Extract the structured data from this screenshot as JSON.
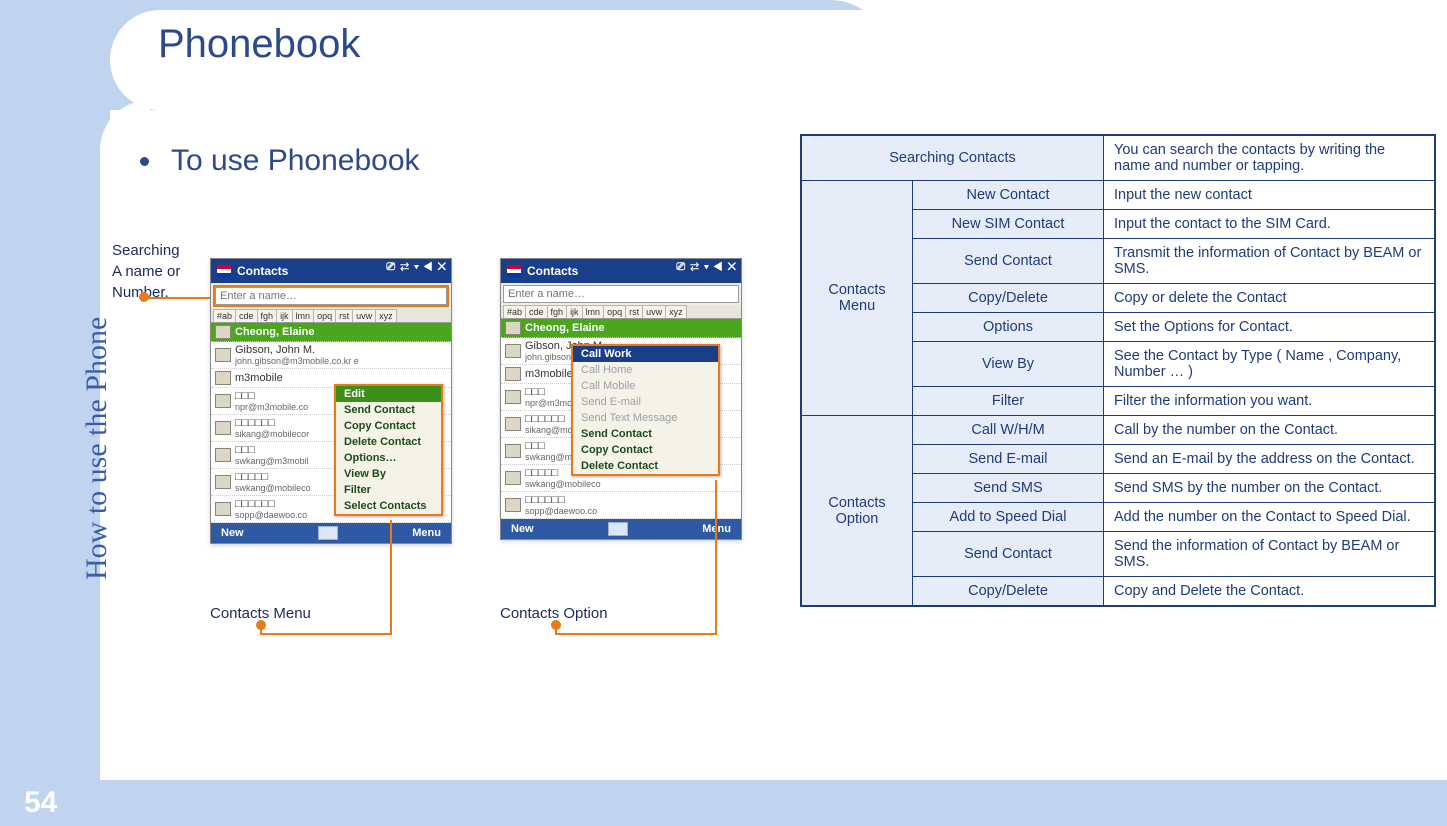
{
  "page": {
    "title": "Phonebook",
    "sidebar_text": "How to use the Phone",
    "sub_title": "To use Phonebook",
    "page_number": "54",
    "search_caption_line1": "Searching",
    "search_caption_line2": "A name or",
    "search_caption_line3": "Number.",
    "caption_menu": "Contacts Menu",
    "caption_option": "Contacts Option"
  },
  "screenshot": {
    "window_title": "Contacts",
    "tray_icons": "⎚ ⇄ ▾ ◀ ✕",
    "input_placeholder": "Enter a name…",
    "alpha_tabs": [
      "#ab",
      "cde",
      "fgh",
      "ijk",
      "lmn",
      "opq",
      "rst",
      "uvw",
      "xyz"
    ],
    "selected_contact": "Cheong, Elaine",
    "contacts": [
      {
        "name": "Gibson, John M.",
        "sub": "john.gibson@m3mobile.co.kr  e"
      },
      {
        "name": "m3mobile",
        "sub": ""
      },
      {
        "name": "□□□",
        "sub": "npr@m3mobile.co"
      },
      {
        "name": "□□□□□□",
        "sub": "sikang@mobilecor"
      },
      {
        "name": "□□□",
        "sub": "swkang@m3mobil"
      },
      {
        "name": "□□□□□",
        "sub": "swkang@mobileco"
      },
      {
        "name": "□□□□□□",
        "sub": "sopp@daewoo.co"
      }
    ],
    "bottom_left": "New",
    "bottom_right": "Menu"
  },
  "menu1": {
    "title": "Edit",
    "items": [
      "Send Contact",
      "Copy Contact",
      "Delete Contact",
      "Options…",
      "View By",
      "Filter",
      "Select Contacts"
    ]
  },
  "menu2": {
    "items_dim": [
      "Call Work",
      "Call Home",
      "Call Mobile",
      "Send E-mail",
      "Send Text Message"
    ],
    "items": [
      "Send Contact",
      "Copy Contact",
      "Delete Contact"
    ]
  },
  "table": {
    "searching": {
      "label": "Searching Contacts",
      "desc": "You can search the contacts by writing  the name and number or tapping."
    },
    "menu_group": "Contacts Menu",
    "option_group": "Contacts Option",
    "menu_rows": [
      {
        "label": "New Contact",
        "desc": "Input the new contact"
      },
      {
        "label": "New SIM Contact",
        "desc": "Input the contact to the SIM Card."
      },
      {
        "label": "Send Contact",
        "desc": "Transmit the information of Contact by BEAM or SMS."
      },
      {
        "label": "Copy/Delete",
        "desc": "Copy or delete the Contact"
      },
      {
        "label": "Options",
        "desc": "Set the Options for Contact."
      },
      {
        "label": "View By",
        "desc": "See the Contact by Type ( Name , Company, Number … )"
      },
      {
        "label": "Filter",
        "desc": "Filter the information you want."
      }
    ],
    "option_rows": [
      {
        "label": "Call W/H/M",
        "desc": "Call by the number on the Contact."
      },
      {
        "label": "Send E-mail",
        "desc": "Send an E-mail by the address on the Contact."
      },
      {
        "label": "Send SMS",
        "desc": "Send SMS  by the number  on the Contact."
      },
      {
        "label": "Add to Speed Dial",
        "desc": "Add the number on the Contact to Speed Dial."
      },
      {
        "label": "Send Contact",
        "desc": "Send the information of Contact by BEAM or SMS."
      },
      {
        "label": "Copy/Delete",
        "desc": "Copy and Delete the Contact."
      }
    ]
  }
}
